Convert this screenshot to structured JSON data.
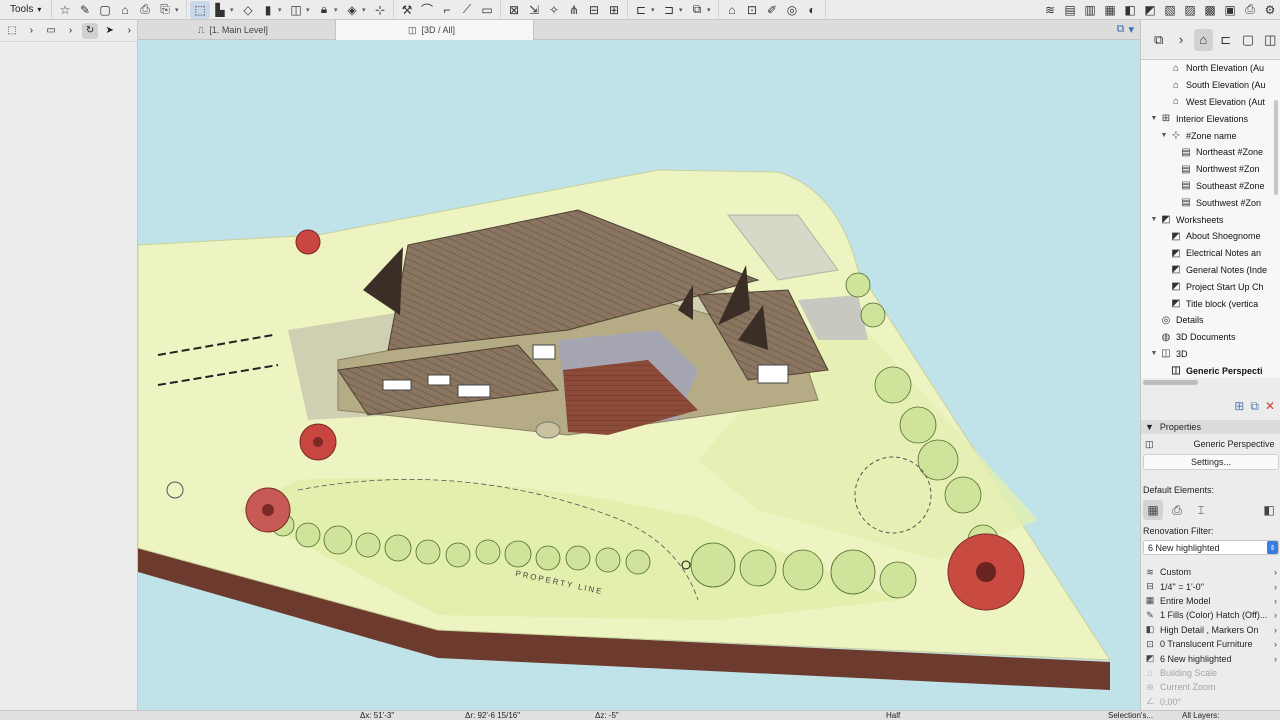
{
  "toolbar": {
    "tools_label": "Tools"
  },
  "tabs": {
    "floor_plan": "[1. Main Level]",
    "three_d": "[3D / All]"
  },
  "navigator": {
    "items": [
      {
        "label": "North Elevation (Au",
        "indent": 2,
        "icon": "elevation-icon",
        "twisty": ""
      },
      {
        "label": "South Elevation (Au",
        "indent": 2,
        "icon": "elevation-icon",
        "twisty": ""
      },
      {
        "label": "West Elevation (Aut",
        "indent": 2,
        "icon": "elevation-icon",
        "twisty": ""
      },
      {
        "label": "Interior Elevations",
        "indent": 1,
        "icon": "interior-elevation-icon",
        "twisty": "▼"
      },
      {
        "label": "#Zone name",
        "indent": 2,
        "icon": "zone-icon",
        "twisty": "▼"
      },
      {
        "label": "Northeast #Zone",
        "indent": 3,
        "icon": "ie-view-icon",
        "twisty": ""
      },
      {
        "label": "Northwest #Zon",
        "indent": 3,
        "icon": "ie-view-icon",
        "twisty": ""
      },
      {
        "label": "Southeast #Zone",
        "indent": 3,
        "icon": "ie-view-icon",
        "twisty": ""
      },
      {
        "label": "Southwest #Zon",
        "indent": 3,
        "icon": "ie-view-icon",
        "twisty": ""
      },
      {
        "label": "Worksheets",
        "indent": 1,
        "icon": "worksheet-icon",
        "twisty": "▼"
      },
      {
        "label": "About Shoegnome",
        "indent": 2,
        "icon": "worksheet-icon",
        "twisty": ""
      },
      {
        "label": "Electrical Notes an",
        "indent": 2,
        "icon": "worksheet-icon",
        "twisty": ""
      },
      {
        "label": "General Notes (Inde",
        "indent": 2,
        "icon": "worksheet-icon",
        "twisty": ""
      },
      {
        "label": "Project Start Up Ch",
        "indent": 2,
        "icon": "worksheet-icon",
        "twisty": ""
      },
      {
        "label": "Title block (vertica",
        "indent": 2,
        "icon": "worksheet-icon",
        "twisty": ""
      },
      {
        "label": "Details",
        "indent": 1,
        "icon": "details-icon",
        "twisty": ""
      },
      {
        "label": "3D Documents",
        "indent": 1,
        "icon": "3d-documents-icon",
        "twisty": ""
      },
      {
        "label": "3D",
        "indent": 1,
        "icon": "3d-icon",
        "twisty": "▼"
      },
      {
        "label": "Generic Perspecti",
        "indent": 2,
        "icon": "perspective-icon",
        "twisty": "",
        "selected": true
      }
    ]
  },
  "properties": {
    "header": "Properties",
    "view_name": "Generic Perspective",
    "settings_label": "Settings...",
    "default_elements_label": "Default Elements:",
    "renovation_label": "Renovation Filter:",
    "renovation_value": "6 New highlighted",
    "rows": [
      {
        "label": "Custom",
        "icon": "layers-icon",
        "dim": false
      },
      {
        "label": "1/4\"   =   1'-0\"",
        "icon": "scale-icon",
        "dim": false
      },
      {
        "label": "Entire Model",
        "icon": "model-icon",
        "dim": false
      },
      {
        "label": "1 Fills (Color) Hatch (Off)...",
        "icon": "pen-icon",
        "dim": false
      },
      {
        "label": "High Detail , Markers On",
        "icon": "detail-icon",
        "dim": false
      },
      {
        "label": "0 Translucent Furniture",
        "icon": "furniture-icon",
        "dim": false
      },
      {
        "label": "6 New highlighted",
        "icon": "renovation-icon",
        "dim": false
      },
      {
        "label": "Building Scale",
        "icon": "building-icon",
        "dim": true
      },
      {
        "label": "Current Zoom",
        "icon": "zoom-icon",
        "dim": true
      },
      {
        "label": "0.00°",
        "icon": "angle-icon",
        "dim": true
      }
    ]
  },
  "viewport": {
    "property_line_label": "PROPERTY LINE"
  },
  "status": {
    "dx": "Δx: 51'-3\"",
    "dr": "Δr: 92'-6 15/16\"",
    "dz": "Δz: -5\"",
    "half": "Half",
    "selections": "Selection's...",
    "layers": "All Layers:"
  }
}
